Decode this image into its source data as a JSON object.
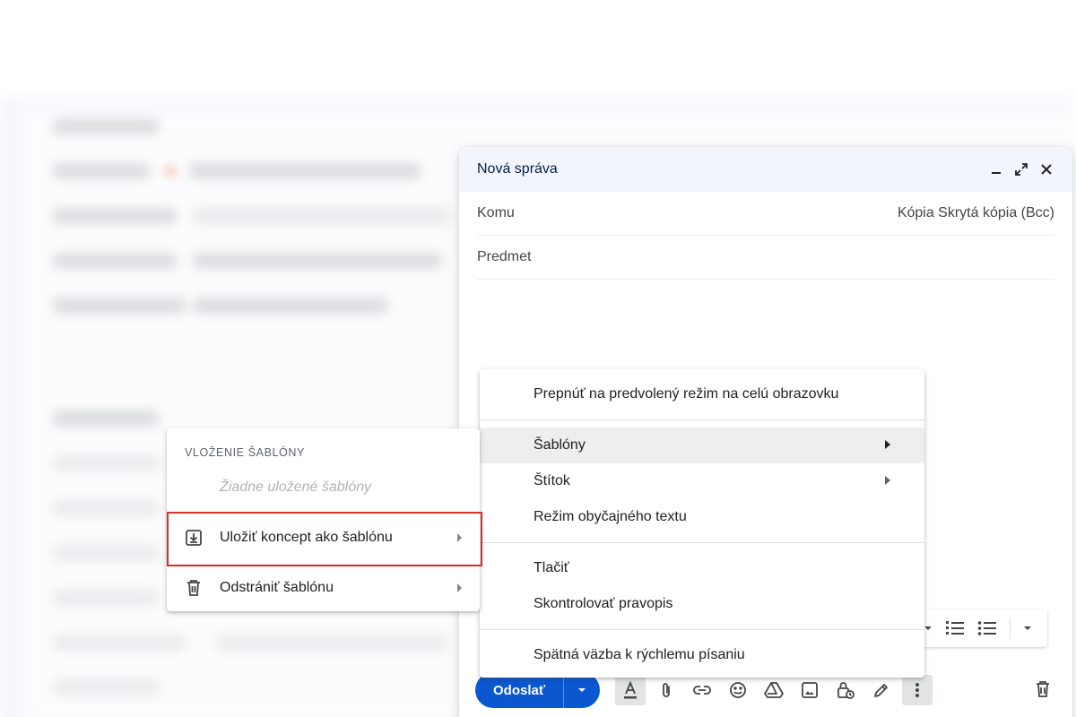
{
  "compose": {
    "title": "Nová správa",
    "to_label": "Komu",
    "cc_bcc": "Kópia Skrytá kópia (Bcc)",
    "subject_placeholder": "Predmet",
    "send_label": "Odoslať"
  },
  "main_menu": {
    "items": [
      {
        "label": "Prepnúť na predvolený režim na celú obrazovku",
        "submenu": false
      },
      {
        "label": "Šablóny",
        "submenu": true,
        "highlighted": true
      },
      {
        "label": "Štítok",
        "submenu": true
      },
      {
        "label": "Režim obyčajného textu",
        "submenu": false
      },
      {
        "label": "Tlačiť",
        "submenu": false
      },
      {
        "label": "Skontrolovať pravopis",
        "submenu": false
      },
      {
        "label": "Spätná väzba k rýchlemu písaniu",
        "submenu": false
      }
    ]
  },
  "templates_menu": {
    "header": "VLOŽENIE ŠABLÓNY",
    "empty_text": "Žiadne uložené šablóny",
    "save_draft": "Uložiť koncept ako šablónu",
    "delete_template": "Odstrániť šablónu"
  },
  "icons": {
    "minimize": "minimize-icon",
    "expand": "expand-icon",
    "close": "close-icon",
    "save_template": "download-box-icon",
    "delete_template": "trash-icon"
  },
  "colors": {
    "accent": "#0b57d0",
    "highlight_border": "#d93025",
    "header_bg": "#f2f6fc"
  }
}
